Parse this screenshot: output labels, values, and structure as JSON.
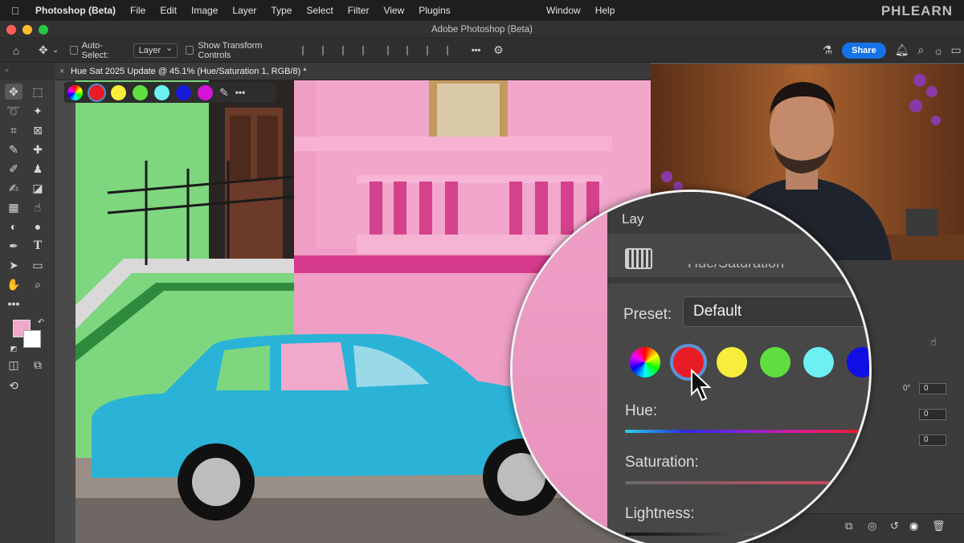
{
  "menubar": {
    "app_name": "Photoshop (Beta)",
    "items": [
      "File",
      "Edit",
      "Image",
      "Layer",
      "Type",
      "Select",
      "Filter",
      "View",
      "Plugins"
    ],
    "right_items": [
      "Window",
      "Help"
    ],
    "watermark": "PHLEARN"
  },
  "window": {
    "title": "Adobe Photoshop (Beta)"
  },
  "options_bar": {
    "auto_select_label": "Auto-Select:",
    "auto_select_value": "Layer",
    "transform_label": "Show Transform Controls",
    "more_label": "•••",
    "share_label": "Share"
  },
  "document": {
    "tab_title": "Hue Sat 2025 Update @ 45.1% (Hue/Saturation 1, RGB/8) *"
  },
  "color_bar": {
    "swatches": [
      "#e81c24",
      "#f7ee3c",
      "#5fdf3f",
      "#6cf0f2",
      "#1a1adb",
      "#d514d5"
    ],
    "more_label": "•••"
  },
  "tools": {
    "foreground_color": "#f0a8cb",
    "background_color": "#ffffff",
    "more_label": "•••"
  },
  "panel": {
    "layers_partial": "Lay",
    "adjustment_title_partial": "Hue/Saturation",
    "values": [
      "0°",
      "0",
      "0",
      "0"
    ]
  },
  "magnifier": {
    "preset_label": "Preset:",
    "preset_value": "Default",
    "hue_label": "Hue:",
    "saturation_label": "Saturation:",
    "lightness_label": "Lightness:",
    "swatches": [
      "#e81c24",
      "#f7ee3c",
      "#5fdf3f",
      "#6cf0f2",
      "#1010e6"
    ]
  }
}
